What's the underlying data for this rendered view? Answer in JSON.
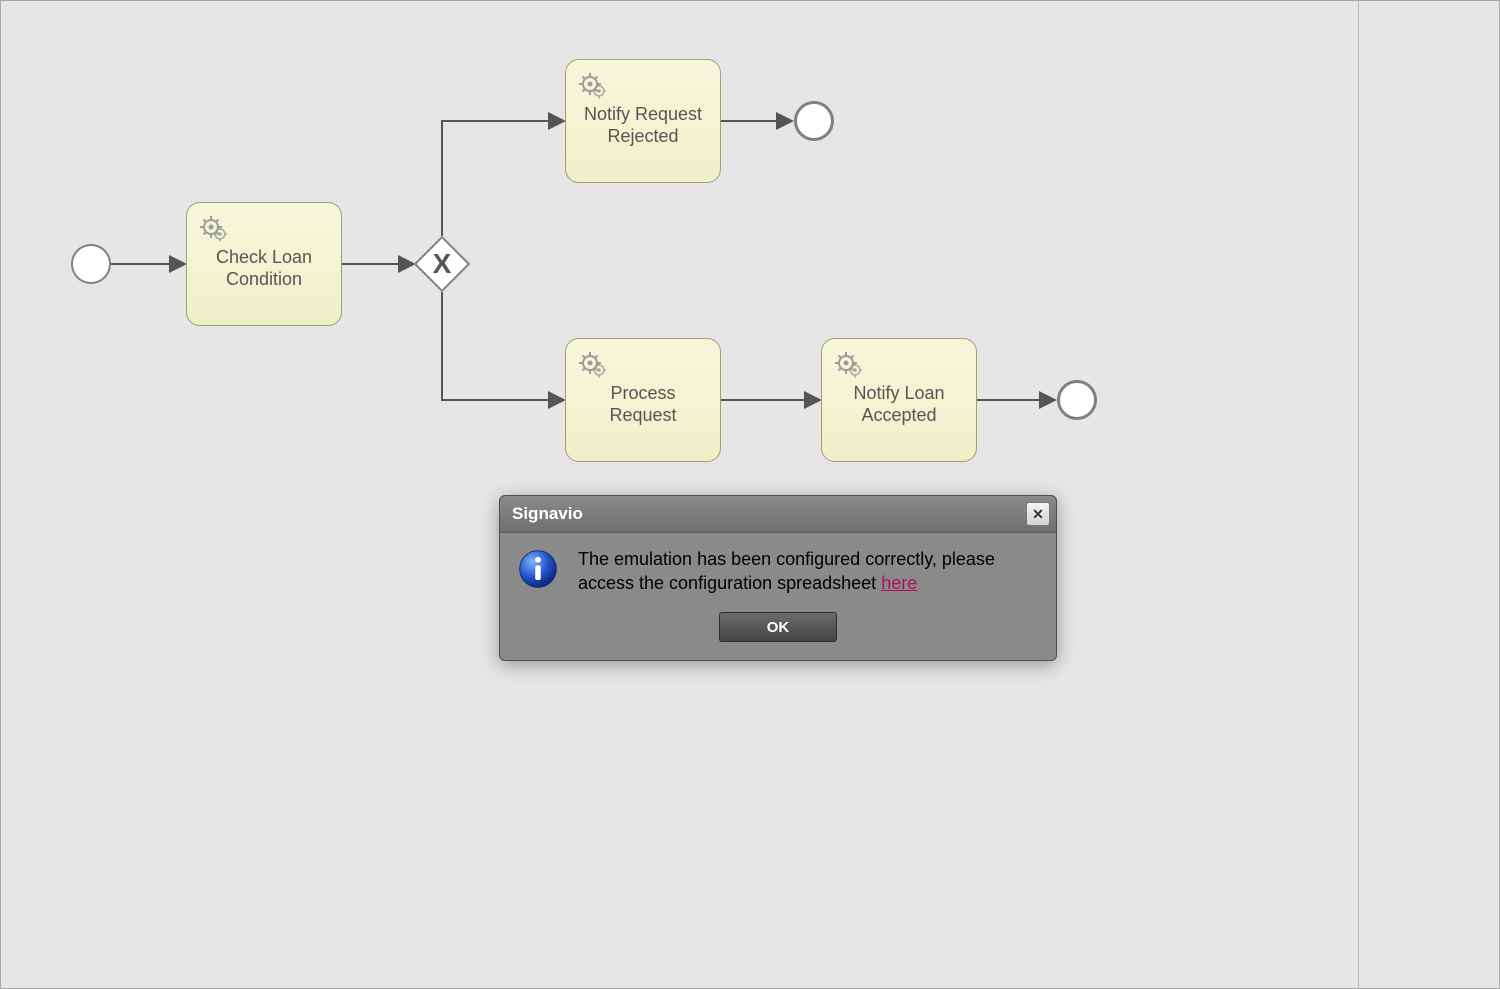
{
  "diagram": {
    "type": "BPMN",
    "tasks": {
      "check_loan": {
        "label": "Check Loan Condition"
      },
      "notify_rejected": {
        "label": "Notify Request Rejected"
      },
      "process_request": {
        "label": "Process Request"
      },
      "notify_accepted": {
        "label": "Notify Loan Accepted"
      }
    },
    "gateway": {
      "marker": "X"
    }
  },
  "dialog": {
    "title": "Signavio",
    "message_part1": "The emulation has been configured correctly, please access the configuration spreadsheet ",
    "link_text": "here",
    "ok_label": "OK",
    "close_label": "X"
  }
}
